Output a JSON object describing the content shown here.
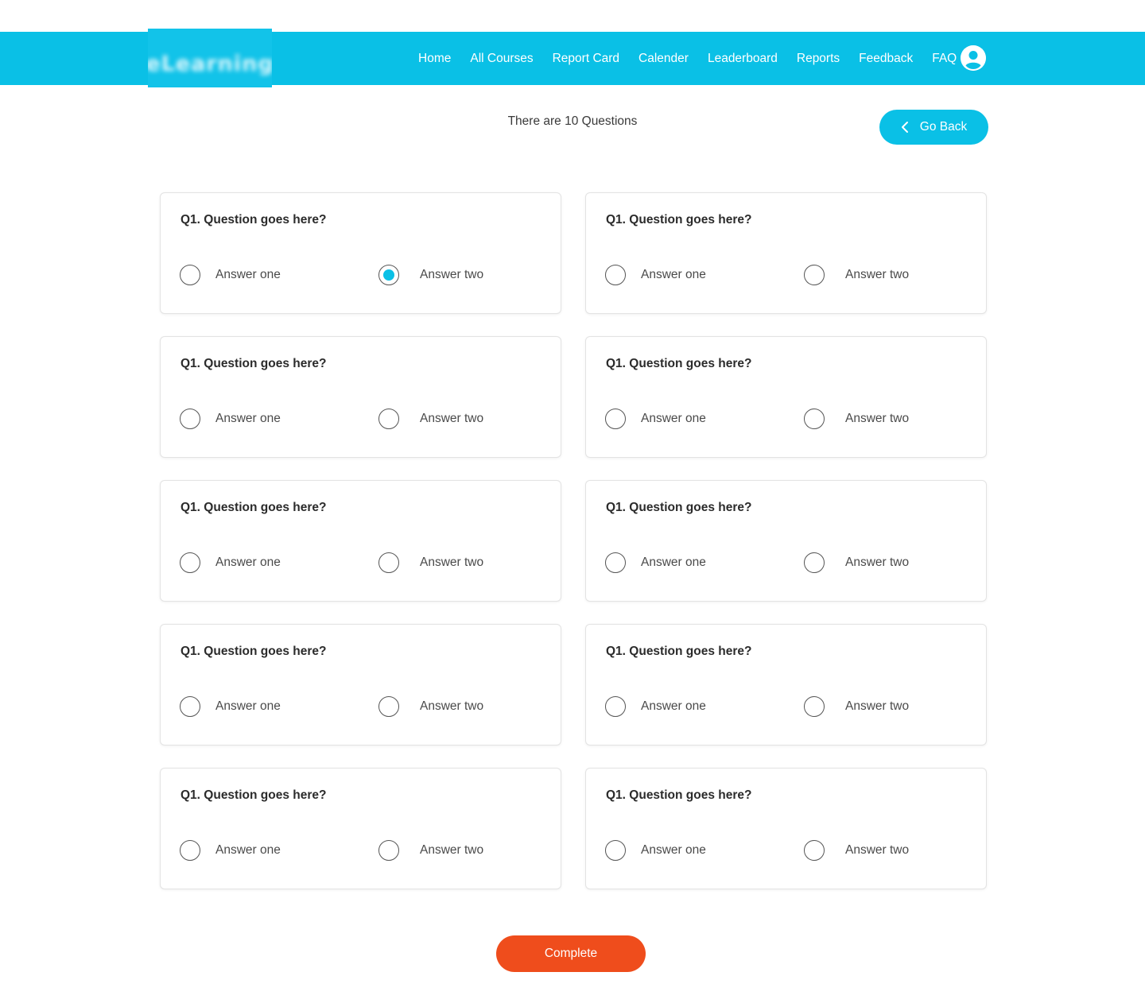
{
  "header": {
    "logo_text": "eLearning",
    "nav": [
      "Home",
      "All Courses",
      "Report Card",
      "Calender",
      "Leaderboard",
      "Reports",
      "Feedback",
      "FAQ"
    ],
    "avatar_icon": "user-circle-icon"
  },
  "quiz": {
    "count_text": "There are 10 Questions",
    "go_back_label": "Go Back",
    "complete_label": "Complete",
    "accent_color": "#0ac0e6",
    "complete_color": "#ef4d1c",
    "questions": [
      {
        "text": "Q1. Question goes here?",
        "options": [
          "Answer one",
          "Answer two"
        ],
        "selected": 1
      },
      {
        "text": "Q1. Question goes here?",
        "options": [
          "Answer one",
          "Answer two"
        ],
        "selected": null
      },
      {
        "text": "Q1. Question goes here?",
        "options": [
          "Answer one",
          "Answer two"
        ],
        "selected": null
      },
      {
        "text": "Q1. Question goes here?",
        "options": [
          "Answer one",
          "Answer two"
        ],
        "selected": null
      },
      {
        "text": "Q1. Question goes here?",
        "options": [
          "Answer one",
          "Answer two"
        ],
        "selected": null
      },
      {
        "text": "Q1. Question goes here?",
        "options": [
          "Answer one",
          "Answer two"
        ],
        "selected": null
      },
      {
        "text": "Q1. Question goes here?",
        "options": [
          "Answer one",
          "Answer two"
        ],
        "selected": null
      },
      {
        "text": "Q1. Question goes here?",
        "options": [
          "Answer one",
          "Answer two"
        ],
        "selected": null
      },
      {
        "text": "Q1. Question goes here?",
        "options": [
          "Answer one",
          "Answer two"
        ],
        "selected": null
      },
      {
        "text": "Q1. Question goes here?",
        "options": [
          "Answer one",
          "Answer two"
        ],
        "selected": null
      }
    ]
  }
}
